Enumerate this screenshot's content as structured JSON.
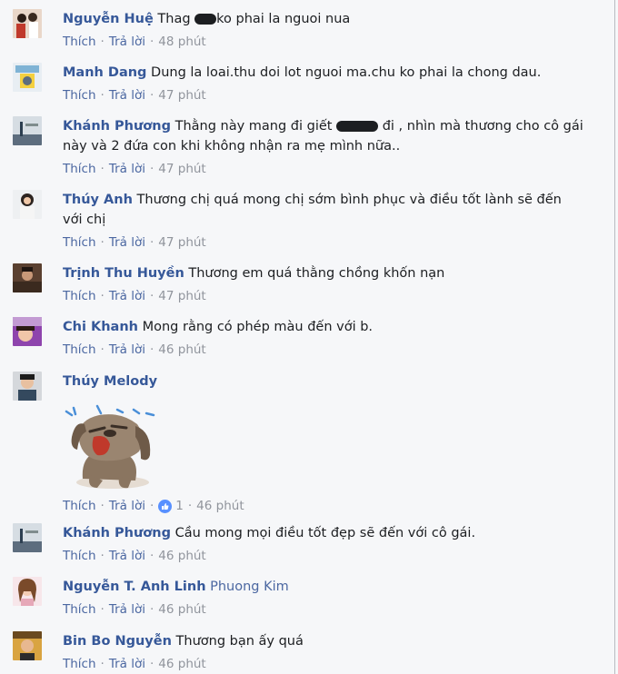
{
  "actions": {
    "like": "Thích",
    "reply": "Trả lời",
    "dot": "·"
  },
  "colors": {
    "name": "#365899",
    "link": "#4b67a1",
    "meta": "#90949c",
    "like_badge": "#5890ff"
  },
  "comments": [
    {
      "name": "Nguyễn Huệ",
      "pre": "Thag ",
      "post": "ko phai la nguoi nua",
      "time": "48 phút"
    },
    {
      "name": "Manh Dang",
      "text": "Dung la loai.thu doi lot nguoi ma.chu ko phai la chong dau.",
      "time": "47 phút"
    },
    {
      "name": "Khánh Phương",
      "pre": "Thằng này mang đi giết ",
      "post": " đi , nhìn mà thương cho cô gái",
      "line2": "này và 2 đứa con khi không nhận ra mẹ mình nữa..",
      "time": "47 phút"
    },
    {
      "name": "Thúy Anh",
      "text": "Thương chị quá mong chị sớm bình phục và điều tốt lành sẽ đến",
      "line2": "với chị",
      "time": "47 phút"
    },
    {
      "name": "Trịnh Thu Huyền",
      "text": "Thương em quá thằng chồng khốn nạn",
      "time": "47 phút"
    },
    {
      "name": "Chi Khanh",
      "text": "Mong rằng có phép màu đến với b.",
      "time": "46 phút"
    },
    {
      "name": "Thúy Melody",
      "sticker": "crying-dog-sticker",
      "likes": "1",
      "time": "46 phút"
    },
    {
      "name": "Khánh Phương",
      "text": "Cầu mong mọi điều tốt đẹp sẽ đến với cô gái.",
      "time": "46 phút"
    },
    {
      "name": "Nguyễn T. Anh Linh",
      "tag": "Phuong Kim",
      "time": "46 phút"
    },
    {
      "name": "Bin Bo Nguyễn",
      "text": "Thương bạn ấy quá",
      "time": "46 phút"
    }
  ]
}
